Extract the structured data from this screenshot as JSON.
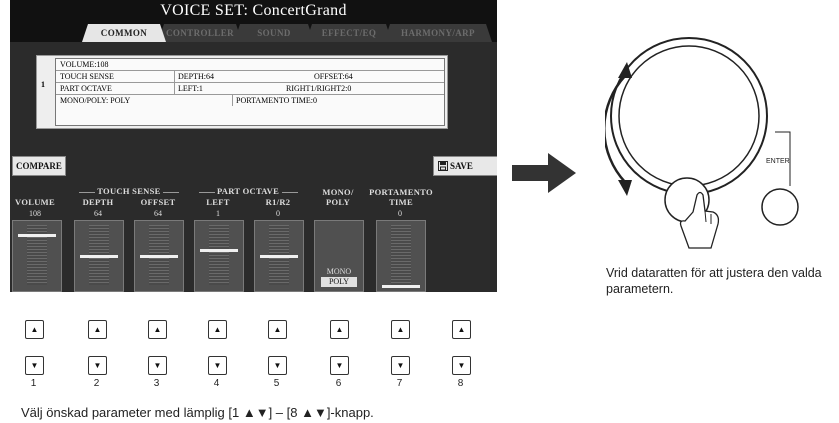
{
  "screen": {
    "title": "VOICE SET: ConcertGrand",
    "tabs": [
      {
        "label": "COMMON",
        "active": true
      },
      {
        "label": "CONTROLLER",
        "active": false
      },
      {
        "label": "SOUND",
        "active": false
      },
      {
        "label": "EFFECT/EQ",
        "active": false
      },
      {
        "label": "HARMONY/ARP",
        "active": false
      }
    ],
    "info": {
      "row_number": "1",
      "volume": "VOLUME:108",
      "touch_sense": "TOUCH SENSE",
      "depth": "DEPTH:64",
      "offset": "OFFSET:64",
      "part_octave": "PART OCTAVE",
      "left": "LEFT:1",
      "right": "RIGHT1/RIGHT2:0",
      "mono_poly": "MONO/POLY: POLY",
      "portamento": "PORTAMENTO TIME:0"
    },
    "compare_label": "COMPARE",
    "save_label": "SAVE",
    "groups": {
      "touch_sense": "TOUCH SENSE",
      "part_octave": "PART OCTAVE"
    },
    "columns": [
      {
        "label": "VOLUME",
        "value": "108",
        "level": 0.85
      },
      {
        "label": "DEPTH",
        "value": "64",
        "level": 0.5
      },
      {
        "label": "OFFSET",
        "value": "64",
        "level": 0.5
      },
      {
        "label": "LEFT",
        "value": "1",
        "level": 0.6
      },
      {
        "label": "R1/R2",
        "value": "0",
        "level": 0.5
      },
      {
        "label": "MONO/ POLY",
        "value": "",
        "level": null
      },
      {
        "label": "PORTAMENTO TIME",
        "value": "0",
        "level": 0.0
      }
    ],
    "mono_option": "MONO",
    "poly_option": "POLY"
  },
  "buttons": {
    "up_glyph": "▲",
    "down_glyph": "▼",
    "numbers": [
      "1",
      "2",
      "3",
      "4",
      "5",
      "6",
      "7",
      "8"
    ]
  },
  "dial": {
    "enter_label": "ENTER",
    "caption": "Vrid dataratten för att justera den valda parametern."
  },
  "caption": "Välj önskad parameter med lämplig [1 ▲▼] – [8 ▲▼]-knapp.",
  "colors": {
    "screen_bg": "#111111",
    "panel_bg": "#2b2b2b",
    "tab_active": "#e6e6e6",
    "arrow": "#333333"
  }
}
